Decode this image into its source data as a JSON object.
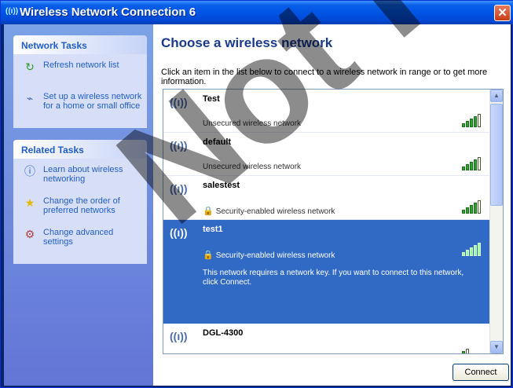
{
  "window": {
    "title": "Wireless Network Connection 6",
    "title_icon": "wireless-icon",
    "close_icon": "close-icon"
  },
  "sidebar": {
    "network_tasks": {
      "header": "Network Tasks",
      "items": [
        {
          "icon": "refresh-icon",
          "label": "Refresh network list"
        },
        {
          "icon": "wireless-setup-icon",
          "label": "Set up a wireless network for a home or small office"
        }
      ]
    },
    "related_tasks": {
      "header": "Related Tasks",
      "items": [
        {
          "icon": "info-icon",
          "label": "Learn about wireless networking"
        },
        {
          "icon": "star-icon",
          "label": "Change the order of preferred networks"
        },
        {
          "icon": "settings-icon",
          "label": "Change advanced settings"
        }
      ]
    }
  },
  "main": {
    "title": "Choose a wireless network",
    "description": "Click an item in the list below to connect to a wireless network in range or to get more information.",
    "networks": [
      {
        "name": "Test",
        "status": "Unsecured wireless network",
        "secured": false,
        "signal": 4,
        "selected": false
      },
      {
        "name": "default",
        "status": "Unsecured wireless network",
        "secured": false,
        "signal": 4,
        "selected": false
      },
      {
        "name": "salestest",
        "status": "Security-enabled wireless network",
        "secured": true,
        "signal": 4,
        "selected": false
      },
      {
        "name": "test1",
        "status": "Security-enabled wireless network",
        "secured": true,
        "signal": 5,
        "selected": true,
        "note": "This network requires a network key. If you want to connect to this network, click Connect."
      },
      {
        "name": "DGL-4300",
        "status": "",
        "secured": false,
        "signal": 1,
        "selected": false
      }
    ],
    "connect_label": "Connect",
    "colors": {
      "selection": "#316ac5",
      "link": "#215dc6",
      "title": "#1a3a8a"
    }
  },
  "overlay": {
    "watermark_text": "Not Final"
  }
}
